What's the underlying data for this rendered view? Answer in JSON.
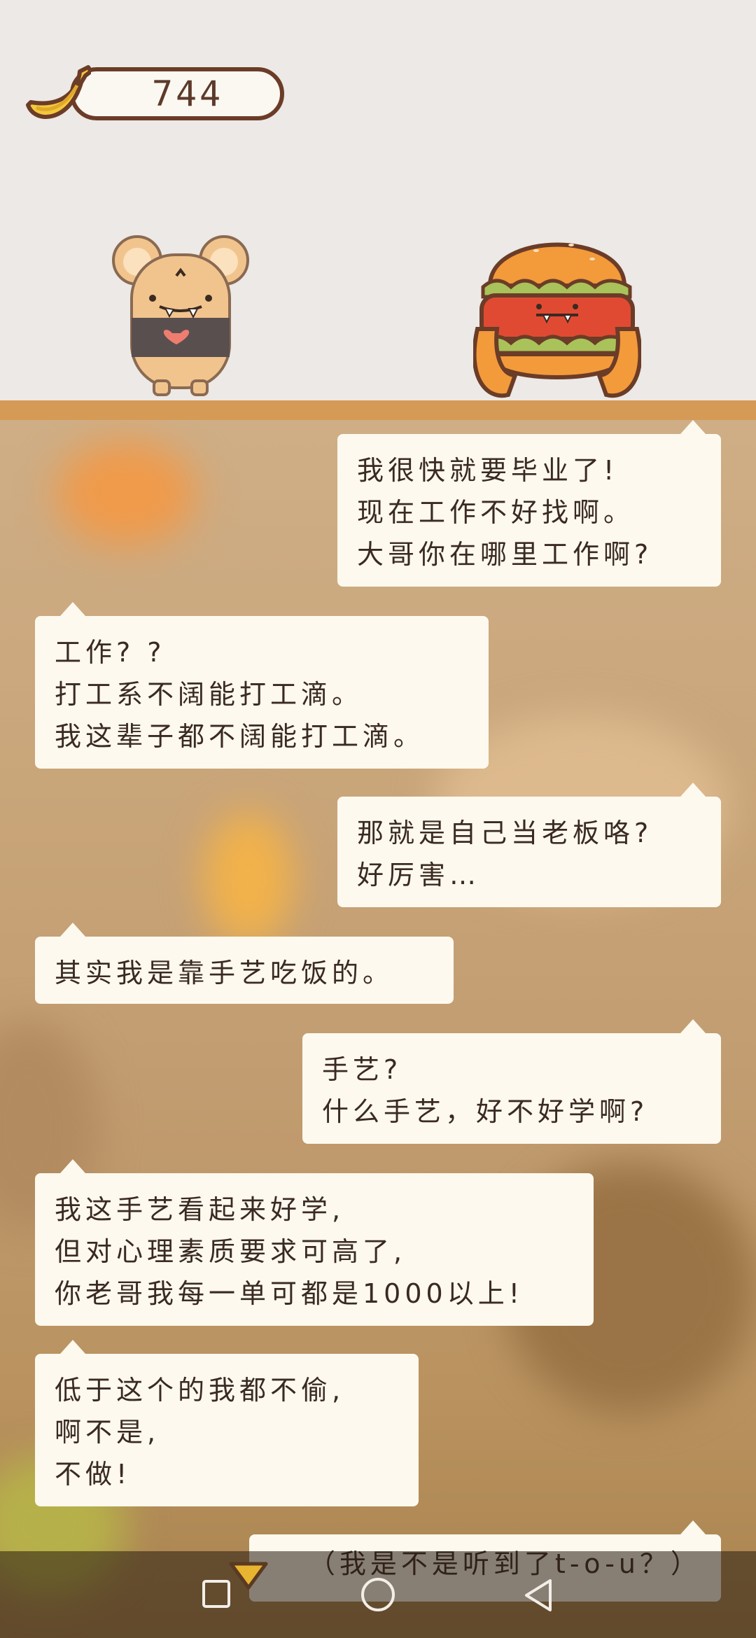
{
  "counter": {
    "value": "744",
    "icon": "banana-icon"
  },
  "characters": {
    "left": "mouse-character",
    "right": "burger-character"
  },
  "dialogue": [
    {
      "side": "right",
      "lines": [
        "我很快就要毕业了!",
        "现在工作不好找啊。",
        "大哥你在哪里工作啊?"
      ]
    },
    {
      "side": "left",
      "lines": [
        "工作? ?",
        "打工系不阔能打工滴。",
        "我这辈子都不阔能打工滴。"
      ]
    },
    {
      "side": "right",
      "lines": [
        "那就是自己当老板咯?",
        "好厉害…"
      ]
    },
    {
      "side": "left",
      "lines": [
        "其实我是靠手艺吃饭的。"
      ]
    },
    {
      "side": "right",
      "lines": [
        "手艺?",
        "什么手艺，好不好学啊?"
      ]
    },
    {
      "side": "left",
      "lines": [
        "我这手艺看起来好学,",
        "但对心理素质要求可高了,",
        "你老哥我每一单可都是1000以上!"
      ]
    },
    {
      "side": "left",
      "lines": [
        "低于这个的我都不偷,",
        "啊不是,",
        "不做!"
      ]
    },
    {
      "side": "right",
      "lines": [
        "（我是不是听到了t-o-u？）"
      ]
    }
  ],
  "navbar": {
    "buttons": [
      "recents-button",
      "home-button",
      "back-button"
    ]
  },
  "colors": {
    "bubble": "#fdf9ee",
    "text": "#3a2a22",
    "floor": "#d59a55",
    "outline": "#6b3c27"
  }
}
